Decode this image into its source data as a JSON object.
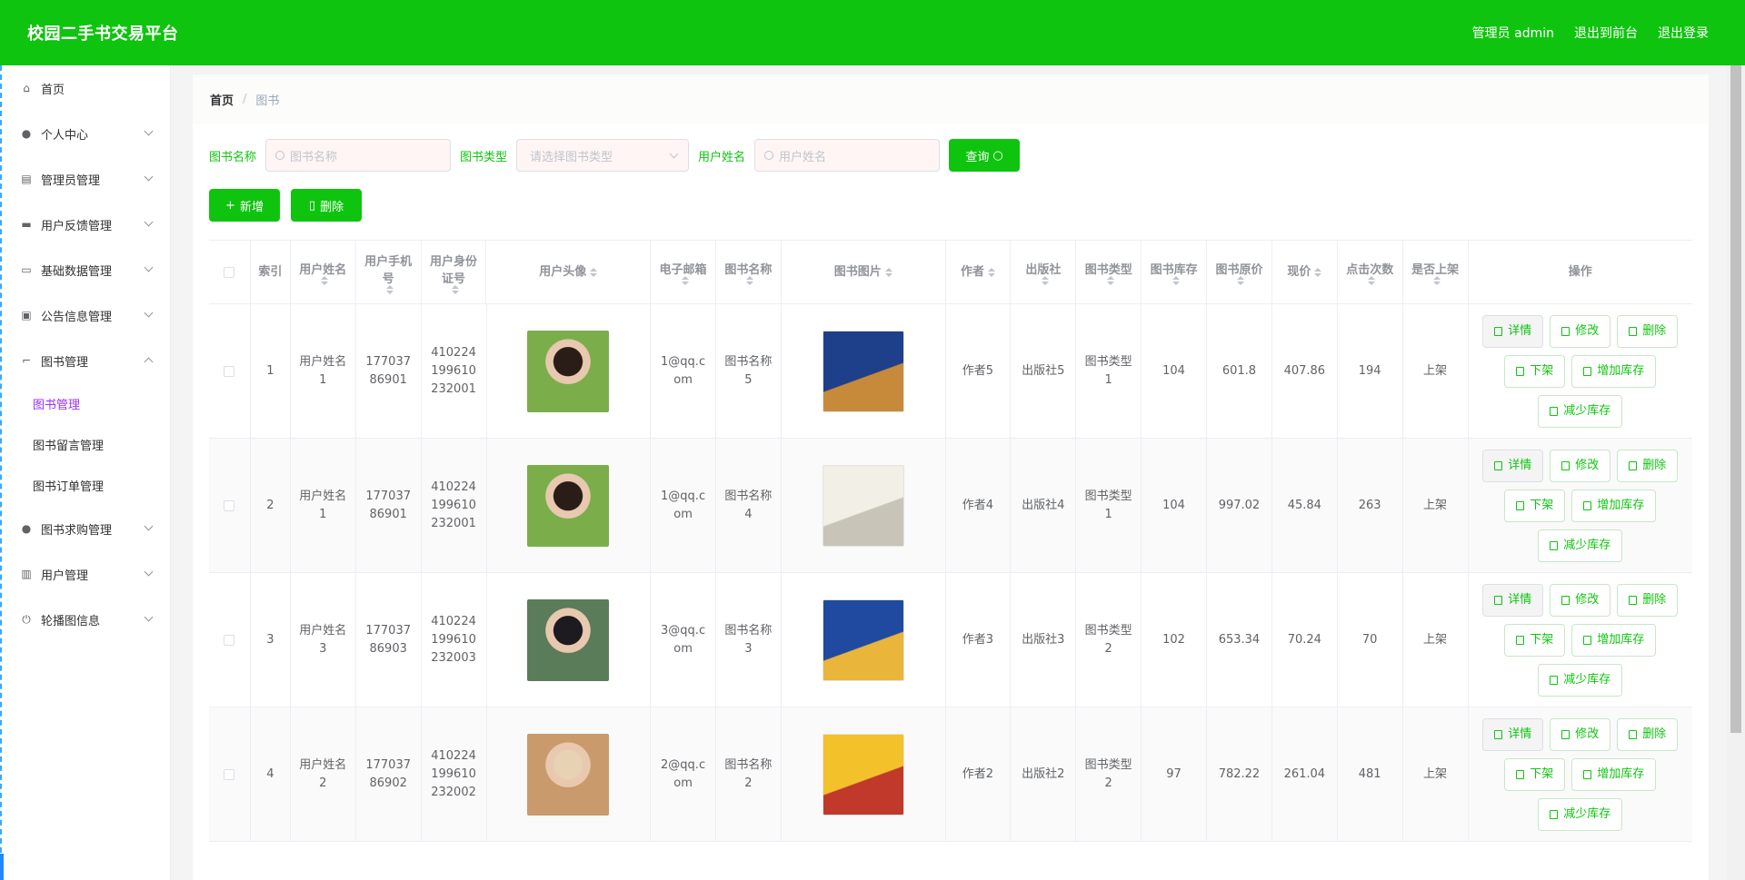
{
  "header": {
    "brand": "校园二手书交易平台",
    "user_label": "管理员 admin",
    "front_link": "退出到前台",
    "logout_link": "退出登录"
  },
  "sidebar": {
    "items": [
      {
        "label": "首页",
        "icon": "home-icon"
      },
      {
        "label": "个人中心",
        "icon": "user-icon"
      },
      {
        "label": "管理员管理",
        "icon": "chart-icon"
      },
      {
        "label": "用户反馈管理",
        "icon": "printer-icon"
      },
      {
        "label": "基础数据管理",
        "icon": "chat-icon"
      },
      {
        "label": "公告信息管理",
        "icon": "clipboard-icon"
      },
      {
        "label": "图书管理",
        "icon": "crop-icon"
      },
      {
        "label": "图书求购管理",
        "icon": "user-icon"
      },
      {
        "label": "用户管理",
        "icon": "bar-chart-icon"
      },
      {
        "label": "轮播图信息",
        "icon": "power-icon"
      }
    ],
    "book_sub": [
      "图书管理",
      "图书留言管理",
      "图书订单管理"
    ]
  },
  "breadcrumb": {
    "home": "首页",
    "sep": "/",
    "current": "图书"
  },
  "search": {
    "book_name_label": "图书名称",
    "book_name_placeholder": "图书名称",
    "book_type_label": "图书类型",
    "book_type_placeholder": "请选择图书类型",
    "user_name_label": "用户姓名",
    "user_name_placeholder": "用户姓名",
    "query_button": "查询"
  },
  "actions": {
    "add": "新增",
    "delete": "删除"
  },
  "table": {
    "headers": [
      "索引",
      "用户姓名",
      "用户手机号",
      "用户身份证号",
      "用户头像",
      "电子邮箱",
      "图书名称",
      "图书图片",
      "作者",
      "出版社",
      "图书类型",
      "图书库存",
      "图书原价",
      "现价",
      "点击次数",
      "是否上架",
      "操作"
    ],
    "op_labels": {
      "detail": "详情",
      "edit": "修改",
      "delete": "删除",
      "offshelf": "下架",
      "add_stock": "增加库存",
      "reduce_stock": "减少库存"
    },
    "rows": [
      {
        "index": "1",
        "user_name": "用户姓名1",
        "phone": "17703786901",
        "id_card": "410224199610232001",
        "email": "1@qq.com",
        "book_name": "图书名称5",
        "author": "作者5",
        "publisher": "出版社5",
        "book_type": "图书类型1",
        "stock": "104",
        "orig_price": "601.8",
        "price": "407.86",
        "clicks": "194",
        "on_shelf": "上架"
      },
      {
        "index": "2",
        "user_name": "用户姓名1",
        "phone": "17703786901",
        "id_card": "410224199610232001",
        "email": "1@qq.com",
        "book_name": "图书名称4",
        "author": "作者4",
        "publisher": "出版社4",
        "book_type": "图书类型1",
        "stock": "104",
        "orig_price": "997.02",
        "price": "45.84",
        "clicks": "263",
        "on_shelf": "上架"
      },
      {
        "index": "3",
        "user_name": "用户姓名3",
        "phone": "17703786903",
        "id_card": "410224199610232003",
        "email": "3@qq.com",
        "book_name": "图书名称3",
        "author": "作者3",
        "publisher": "出版社3",
        "book_type": "图书类型2",
        "stock": "102",
        "orig_price": "653.34",
        "price": "70.24",
        "clicks": "70",
        "on_shelf": "上架"
      },
      {
        "index": "4",
        "user_name": "用户姓名2",
        "phone": "17703786902",
        "id_card": "410224199610232002",
        "email": "2@qq.com",
        "book_name": "图书名称2",
        "author": "作者2",
        "publisher": "出版社2",
        "book_type": "图书类型2",
        "stock": "97",
        "orig_price": "782.22",
        "price": "261.04",
        "clicks": "481",
        "on_shelf": "上架"
      }
    ]
  },
  "colors": {
    "brand_green": "#0fc40f",
    "active_purple": "#9b30ff"
  }
}
